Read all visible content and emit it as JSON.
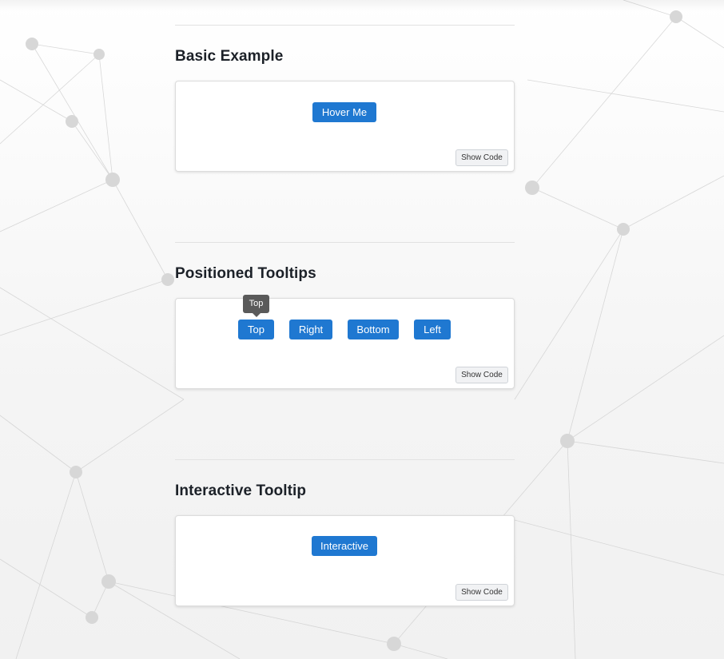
{
  "sections": [
    {
      "title": "Basic Example",
      "buttons": [
        {
          "label": "Hover Me"
        }
      ],
      "code_button": "Show Code"
    },
    {
      "title": "Positioned Tooltips",
      "buttons": [
        {
          "label": "Top"
        },
        {
          "label": "Right"
        },
        {
          "label": "Bottom"
        },
        {
          "label": "Left"
        }
      ],
      "tooltip": {
        "text": "Top",
        "placement": "top"
      },
      "code_button": "Show Code"
    },
    {
      "title": "Interactive Tooltip",
      "buttons": [
        {
          "label": "Interactive"
        }
      ],
      "code_button": "Show Code"
    }
  ],
  "colors": {
    "primary_button": "#1f78d1",
    "tooltip_bg": "#5a5a5a",
    "card_bg": "#ffffff"
  }
}
